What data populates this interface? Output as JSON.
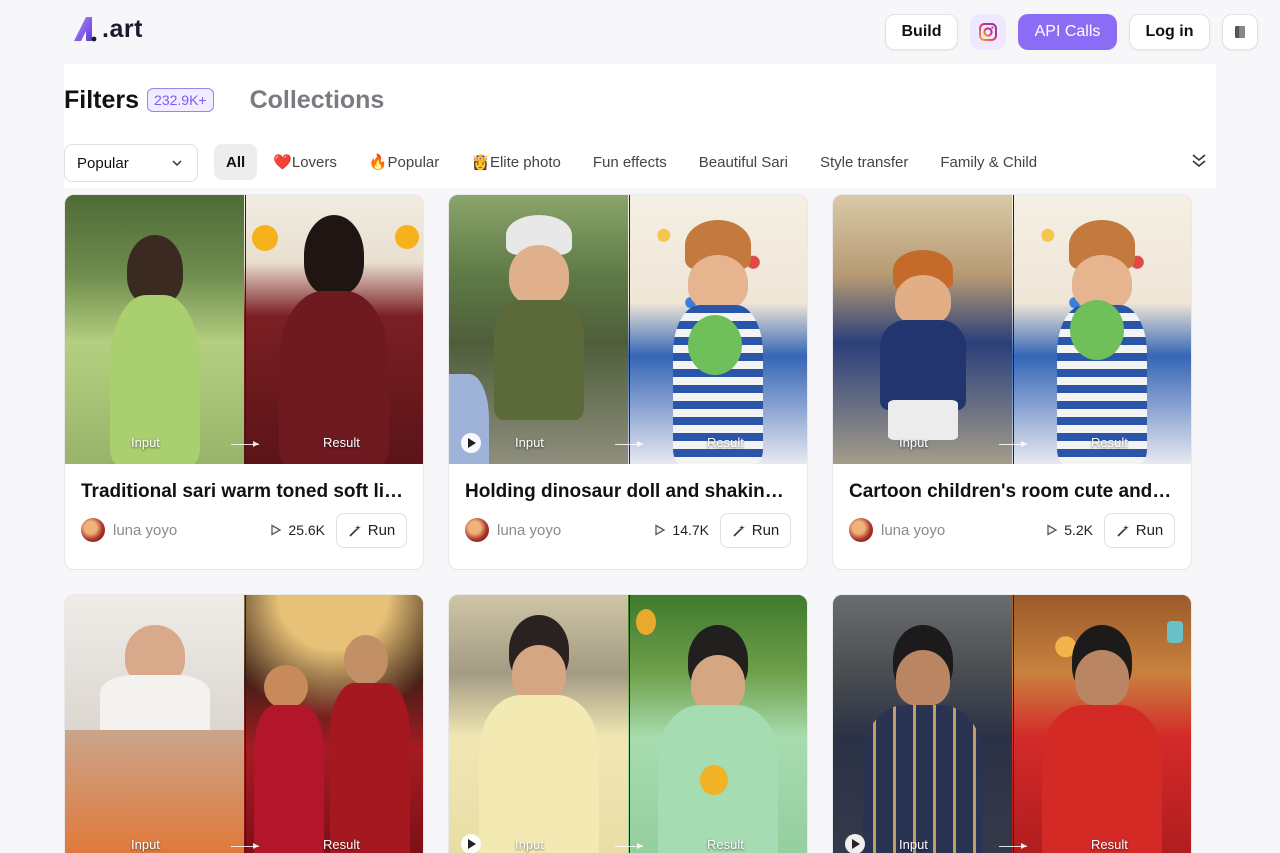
{
  "brand": {
    "logo_text": ".art"
  },
  "header": {
    "build_label": "Build",
    "api_label": "API Calls",
    "login_label": "Log in"
  },
  "tabs": {
    "filters_label": "Filters",
    "filters_count": "232.9K+",
    "collections_label": "Collections"
  },
  "sort": {
    "selected": "Popular"
  },
  "chips": [
    {
      "label": "All",
      "active": true
    },
    {
      "label": "❤️Lovers",
      "active": false
    },
    {
      "label": "🔥Popular",
      "active": false
    },
    {
      "label": "👸Elite photo",
      "active": false
    },
    {
      "label": "Fun effects",
      "active": false
    },
    {
      "label": "Beautiful Sari",
      "active": false
    },
    {
      "label": "Style transfer",
      "active": false
    },
    {
      "label": "Family & Child",
      "active": false
    }
  ],
  "labels": {
    "input": "Input",
    "result": "Result",
    "run": "Run"
  },
  "cards": [
    {
      "title": "Traditional sari warm toned soft light portrait",
      "author": "luna yoyo",
      "runs": "25.6K"
    },
    {
      "title": "Holding dinosaur doll and shaking head",
      "author": "luna yoyo",
      "runs": "14.7K"
    },
    {
      "title": "Cartoon children's room cute and playful",
      "author": "luna yoyo",
      "runs": "5.2K"
    },
    {
      "title": ""
    },
    {
      "title": ""
    },
    {
      "title": ""
    }
  ],
  "colors": {
    "accent": "#8b6cf5",
    "badge_bg": "#f1ecff"
  }
}
